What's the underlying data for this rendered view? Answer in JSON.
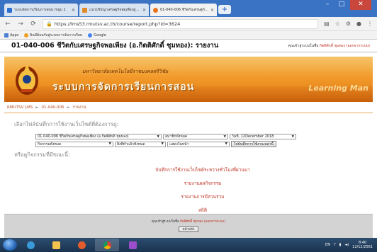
{
  "browser": {
    "tabs": [
      {
        "title": "ระบบจัดการเรียนการสอน mgu 1",
        "active": false,
        "color": "#2e6fd0"
      },
      {
        "title": "แนวปรัชญาเศรษฐกิจพอเพียงสู่การพัฒนา",
        "active": false,
        "color": "#e08a2a"
      },
      {
        "title": "01-040-006 ชีวิตกับเศรษฐกิจพอเพียง",
        "active": true,
        "color": "#e8731c"
      }
    ],
    "new_tab": "+",
    "url": "https://lms53.rmutsv.ac.th/course/report.php?id=3624",
    "bookmarks": [
      {
        "label": "Apps",
        "color": "#4a7fd4"
      },
      {
        "label": "ยินดีต้อนรับสู่ระบบการจัดการเรียน",
        "color": "#f0a020"
      },
      {
        "label": "Google",
        "color": "#4285f4"
      }
    ]
  },
  "header": {
    "title": "01-040-006 ชีวิตกับเศรษฐกิจพอเพียง (อ.กิตติศักดิ์ ชุมทอง): รายงาน",
    "login_prefix": "คุณเข้าสู่ระบบในชื่อ",
    "user": "กิตติศักดิ์ ชุมทอง",
    "logout": "(ออกจากระบบ)"
  },
  "banner": {
    "subtitle": "มหาวิทยาลัยเทคโนโลยีราชมงคลศรีวิชัย",
    "main": "ระบบการจัดการเรียนการสอน",
    "tagline": "Learning Man"
  },
  "breadcrumb": [
    "RMUTSV LMS",
    "01-040-006",
    "รายงาน"
  ],
  "breadcrumb_sep": "►",
  "form": {
    "prompt": "เลือกไฟล์บันทึกการใช้งานเว็บไซต์ที่ต้องการดู:",
    "course_select": "01-040-006 ชีวิตกับเศรษฐกิจพอเพียง (อ.กิตติศักดิ์ ชุมทอง)",
    "members_select": "สมาชิกทั้งหมด",
    "date_select": "วันที่, 12December 2018",
    "activity_select": "กิจกรรมทั้งหมด",
    "actions_select": "สิ่งที่ทำแล้วทั้งหมด",
    "display_select": "แสดงในหน้า",
    "submit_button": "ไปบันทึกการใช้งานเหล่านี้"
  },
  "prompt2": "หรือดูกิจกรรมที่มีขณะนี้:",
  "links": [
    "บันทึกการใช้งานเว็บไซต์ระหว่างชั่วโมงที่ผ่านมา",
    "รายงานผลกิจกรรม",
    "รายงานการมีส่วนร่วม",
    "สถิติ"
  ],
  "footer": {
    "login_prefix": "คุณเข้าสู่ระบบในชื่อ",
    "user": "กิตติศักดิ์ ชุมทอง",
    "logout": "(ออกจากระบบ)",
    "home_button": "หน้าหลัก"
  },
  "taskbar": {
    "apps": [
      {
        "name": "ie",
        "color": "#3a9ad9"
      },
      {
        "name": "folder",
        "color": "#f2c14e"
      },
      {
        "name": "media",
        "color": "#e45c2b"
      },
      {
        "name": "chrome",
        "color": "#4caf50"
      },
      {
        "name": "stack",
        "color": "#9c4dcc"
      }
    ],
    "lang": "EN",
    "time": "8:40",
    "date": "12/12/2561"
  },
  "colors": {
    "chrome_blue": "#3b73c4",
    "link_red": "#c0392b",
    "banner_orange": "#f29a2a"
  }
}
